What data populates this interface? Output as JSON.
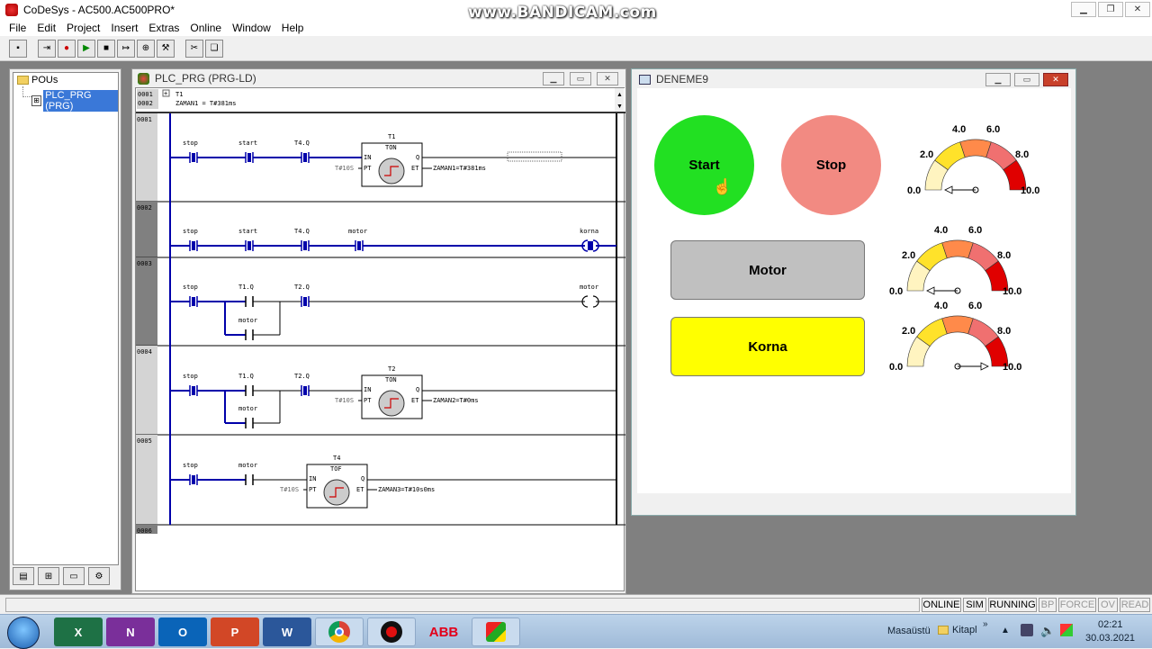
{
  "title_bar": {
    "app_title": "CoDeSys - AC500.AC500PRO*",
    "watermark": "www.BANDICAM.com"
  },
  "menu": [
    "File",
    "Edit",
    "Project",
    "Insert",
    "Extras",
    "Online",
    "Window",
    "Help"
  ],
  "pou_panel": {
    "root": "POUs",
    "item": "PLC_PRG (PRG)"
  },
  "plc_window": {
    "title": "PLC_PRG (PRG-LD)",
    "decl_line_1_no": "0001",
    "decl_line_1": "T1",
    "decl_line_2_no": "0002",
    "decl_line_2": "ZAMAN1 = T#381ms",
    "networks": [
      {
        "no": "0001",
        "contacts": [
          "stop",
          "start",
          "T4.Q"
        ],
        "fb_name": "T1",
        "fb_type": "TON",
        "pt": "T#10S",
        "et": "ZAMAN1=T#381ms"
      },
      {
        "no": "0002",
        "contacts": [
          "stop",
          "start",
          "T4.Q",
          "motor"
        ],
        "coil": "korna"
      },
      {
        "no": "0003",
        "contacts": [
          "stop",
          "T1.Q",
          "T2.Q"
        ],
        "branch": "motor",
        "coil": "motor"
      },
      {
        "no": "0004",
        "contacts": [
          "stop",
          "T1.Q",
          "T2.Q"
        ],
        "branch": "motor",
        "fb_name": "T2",
        "fb_type": "TON",
        "pt": "T#10S",
        "et": "ZAMAN2=T#0ms"
      },
      {
        "no": "0005",
        "contacts": [
          "stop",
          "motor"
        ],
        "fb_name": "T4",
        "fb_type": "TOF",
        "pt": "T#10S",
        "et": "ZAMAN3=T#10s0ms"
      },
      {
        "no": "0006"
      }
    ],
    "fb_pins": {
      "in": "IN",
      "pt": "PT",
      "q": "Q",
      "et": "ET"
    }
  },
  "viz_window": {
    "title": "DENEME9",
    "start_label": "Start",
    "stop_label": "Stop",
    "motor_label": "Motor",
    "korna_label": "Korna",
    "gauge_labels": [
      "0.0",
      "2.0",
      "4.0",
      "6.0",
      "8.0",
      "10.0"
    ],
    "gauges": [
      {
        "value": 0
      },
      {
        "value": 0
      },
      {
        "value": 10
      }
    ]
  },
  "status": [
    "ONLINE",
    "SIM",
    "RUNNING",
    "BP",
    "FORCE",
    "OV",
    "READ"
  ],
  "taskbar": {
    "desktop_label": "Masaüstü",
    "library_label": "Kitapl",
    "time": "02:21",
    "date": "30.03.2021"
  },
  "colors": {
    "start": "#22e022",
    "stop": "#f28a82",
    "motor": "#c0c0c0",
    "korna": "#ffff00",
    "rung": "#0000aa"
  }
}
